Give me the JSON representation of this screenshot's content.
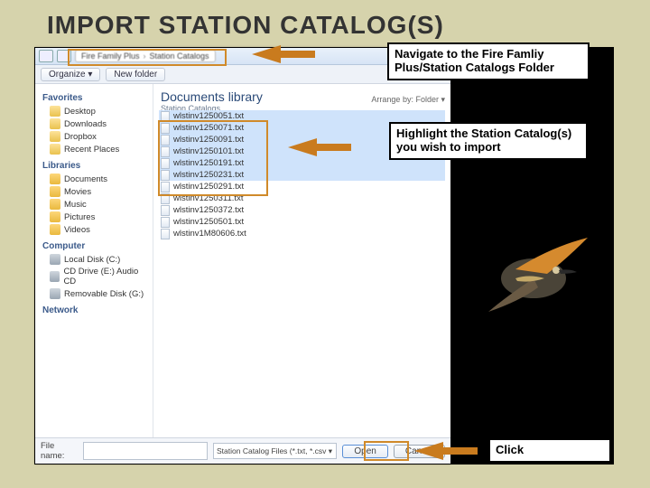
{
  "slide_title": "IMPORT STATION CATALOG(S)",
  "callouts": {
    "c1": "Navigate to the Fire Famliy Plus/Station Catalogs Folder",
    "c2": "Highlight the Station Catalog(s) you wish to import",
    "c3": "Click"
  },
  "breadcrumb": {
    "p1": "Fire Family Plus",
    "p2": "Station Catalogs"
  },
  "toolbar": {
    "organize": "Organize ▾",
    "newfolder": "New folder"
  },
  "library": {
    "title": "Documents library",
    "subtitle": "Station Catalogs",
    "arrange_label": "Arrange by:",
    "arrange_value": "Folder ▾"
  },
  "nav": {
    "favorites_title": "Favorites",
    "favorites": [
      {
        "label": "Desktop"
      },
      {
        "label": "Downloads"
      },
      {
        "label": "Dropbox"
      },
      {
        "label": "Recent Places"
      }
    ],
    "libraries_title": "Libraries",
    "libraries": [
      {
        "label": "Documents"
      },
      {
        "label": "Movies"
      },
      {
        "label": "Music"
      },
      {
        "label": "Pictures"
      },
      {
        "label": "Videos"
      }
    ],
    "computer_title": "Computer",
    "computer": [
      {
        "label": "Local Disk (C:)"
      },
      {
        "label": "CD Drive (E:) Audio CD"
      },
      {
        "label": "Removable Disk (G:)"
      }
    ],
    "network_title": "Network"
  },
  "files": [
    {
      "name": "wlstinv1250051.txt",
      "selected": true
    },
    {
      "name": "wlstinv1250071.txt",
      "selected": true
    },
    {
      "name": "wlstinv1250091.txt",
      "selected": true
    },
    {
      "name": "wlstinv1250101.txt",
      "selected": true
    },
    {
      "name": "wlstinv1250191.txt",
      "selected": true
    },
    {
      "name": "wlstinv1250231.txt",
      "selected": true
    },
    {
      "name": "wlstinv1250291.txt",
      "selected": false
    },
    {
      "name": "wlstinv1250311.txt",
      "selected": false
    },
    {
      "name": "wlstinv1250372.txt",
      "selected": false
    },
    {
      "name": "wlstinv1250501.txt",
      "selected": false
    },
    {
      "name": "wlstinv1M80606.txt",
      "selected": false
    }
  ],
  "footer": {
    "filename_label": "File name:",
    "filter": "Station Catalog Files (*.txt, *.csv ▾",
    "open": "Open",
    "cancel": "Cancel"
  }
}
